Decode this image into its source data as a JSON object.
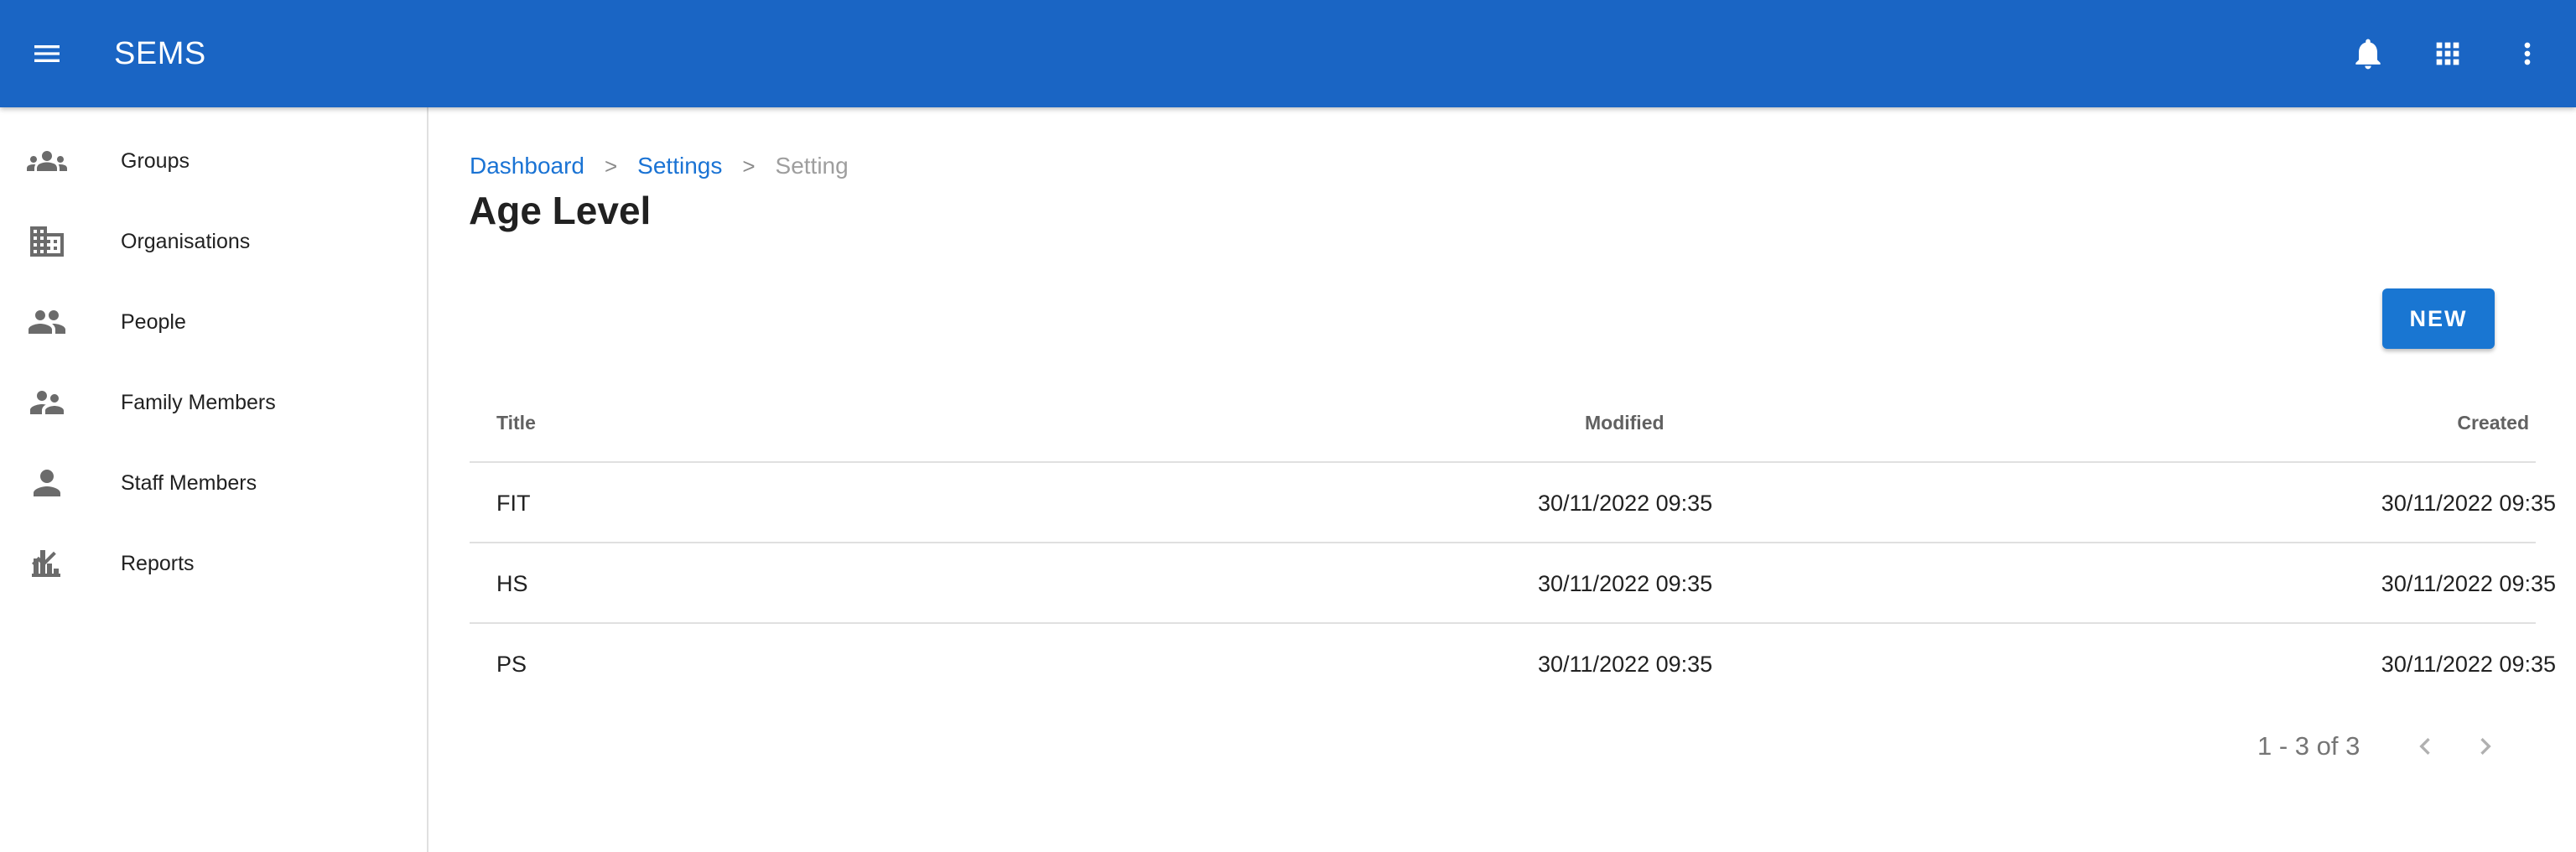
{
  "app": {
    "title": "SEMS",
    "icons": [
      "menu-icon",
      "bell-icon",
      "apps-grid-icon",
      "more-vert-icon"
    ],
    "brand_color": "#1a65c4"
  },
  "sidebar": {
    "items": [
      {
        "label": "Groups",
        "icon": "groups-icon"
      },
      {
        "label": "Organisations",
        "icon": "building-icon"
      },
      {
        "label": "People",
        "icon": "people-icon"
      },
      {
        "label": "Family Members",
        "icon": "family-icon"
      },
      {
        "label": "Staff Members",
        "icon": "person-icon"
      },
      {
        "label": "Reports",
        "icon": "chart-icon"
      }
    ]
  },
  "breadcrumb": {
    "items": [
      "Dashboard",
      "Settings",
      "Setting"
    ],
    "separator": ">"
  },
  "page": {
    "title": "Age Level",
    "new_button": "NEW"
  },
  "table": {
    "columns": [
      "Title",
      "Modified",
      "Created"
    ],
    "rows": [
      {
        "title": "FIT",
        "modified": "30/11/2022 09:35",
        "created": "30/11/2022 09:35"
      },
      {
        "title": "HS",
        "modified": "30/11/2022 09:35",
        "created": "30/11/2022 09:35"
      },
      {
        "title": "PS",
        "modified": "30/11/2022 09:35",
        "created": "30/11/2022 09:35"
      }
    ]
  },
  "pagination": {
    "text": "1 - 3 of 3",
    "icons": [
      "chevron-left-icon",
      "chevron-right-icon"
    ]
  }
}
